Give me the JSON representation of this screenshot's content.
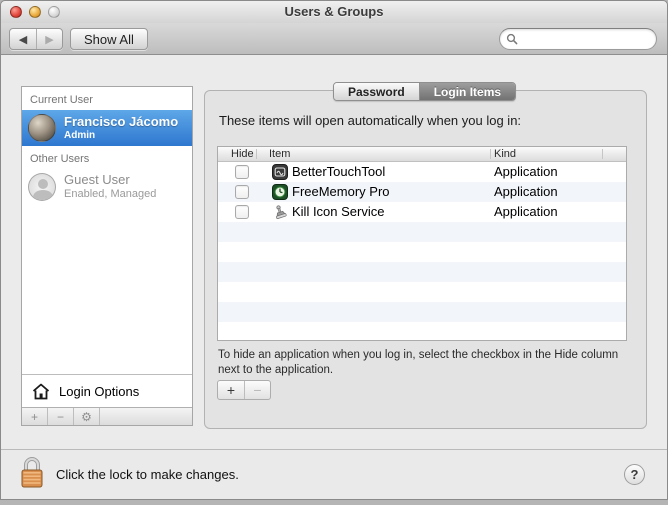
{
  "window": {
    "title": "Users & Groups"
  },
  "toolbar": {
    "back_glyph": "◀",
    "forward_glyph": "▶",
    "show_all_label": "Show All",
    "search_placeholder": ""
  },
  "sidebar": {
    "current_user_header": "Current User",
    "current_user": {
      "name": "Francisco Jácomo",
      "detail": "Admin"
    },
    "other_users_header": "Other Users",
    "other_user": {
      "name": "Guest User",
      "detail": "Enabled, Managed"
    },
    "login_options_label": "Login Options",
    "footer_buttons": {
      "add": "+",
      "remove": "−",
      "gear": "⚙"
    }
  },
  "tabs": {
    "password": "Password",
    "login_items": "Login Items"
  },
  "main": {
    "description": "These items will open automatically when you log in:",
    "table": {
      "columns": [
        "Hide",
        "Item",
        "Kind"
      ],
      "rows": [
        {
          "item": "BetterTouchTool",
          "kind": "Application",
          "icon": "bettertouchtool-icon",
          "hidden": false
        },
        {
          "item": "FreeMemory Pro",
          "kind": "Application",
          "icon": "freememory-pro-icon",
          "hidden": false
        },
        {
          "item": "Kill Icon Service",
          "kind": "Application",
          "icon": "kill-icon-service-icon",
          "hidden": false
        }
      ]
    },
    "help_text": "To hide an application when you log in, select the checkbox in the Hide column next to the application.",
    "add_label": "+",
    "remove_label": "−"
  },
  "footer": {
    "lock_text": "Click the lock to make changes.",
    "help_label": "?"
  },
  "colors": {
    "selection_blue": "#3d87d9",
    "selected_tab_gray": "#868686",
    "lock_body_orange": "#d98f4e",
    "row_stripe": "#f2f5fa"
  }
}
